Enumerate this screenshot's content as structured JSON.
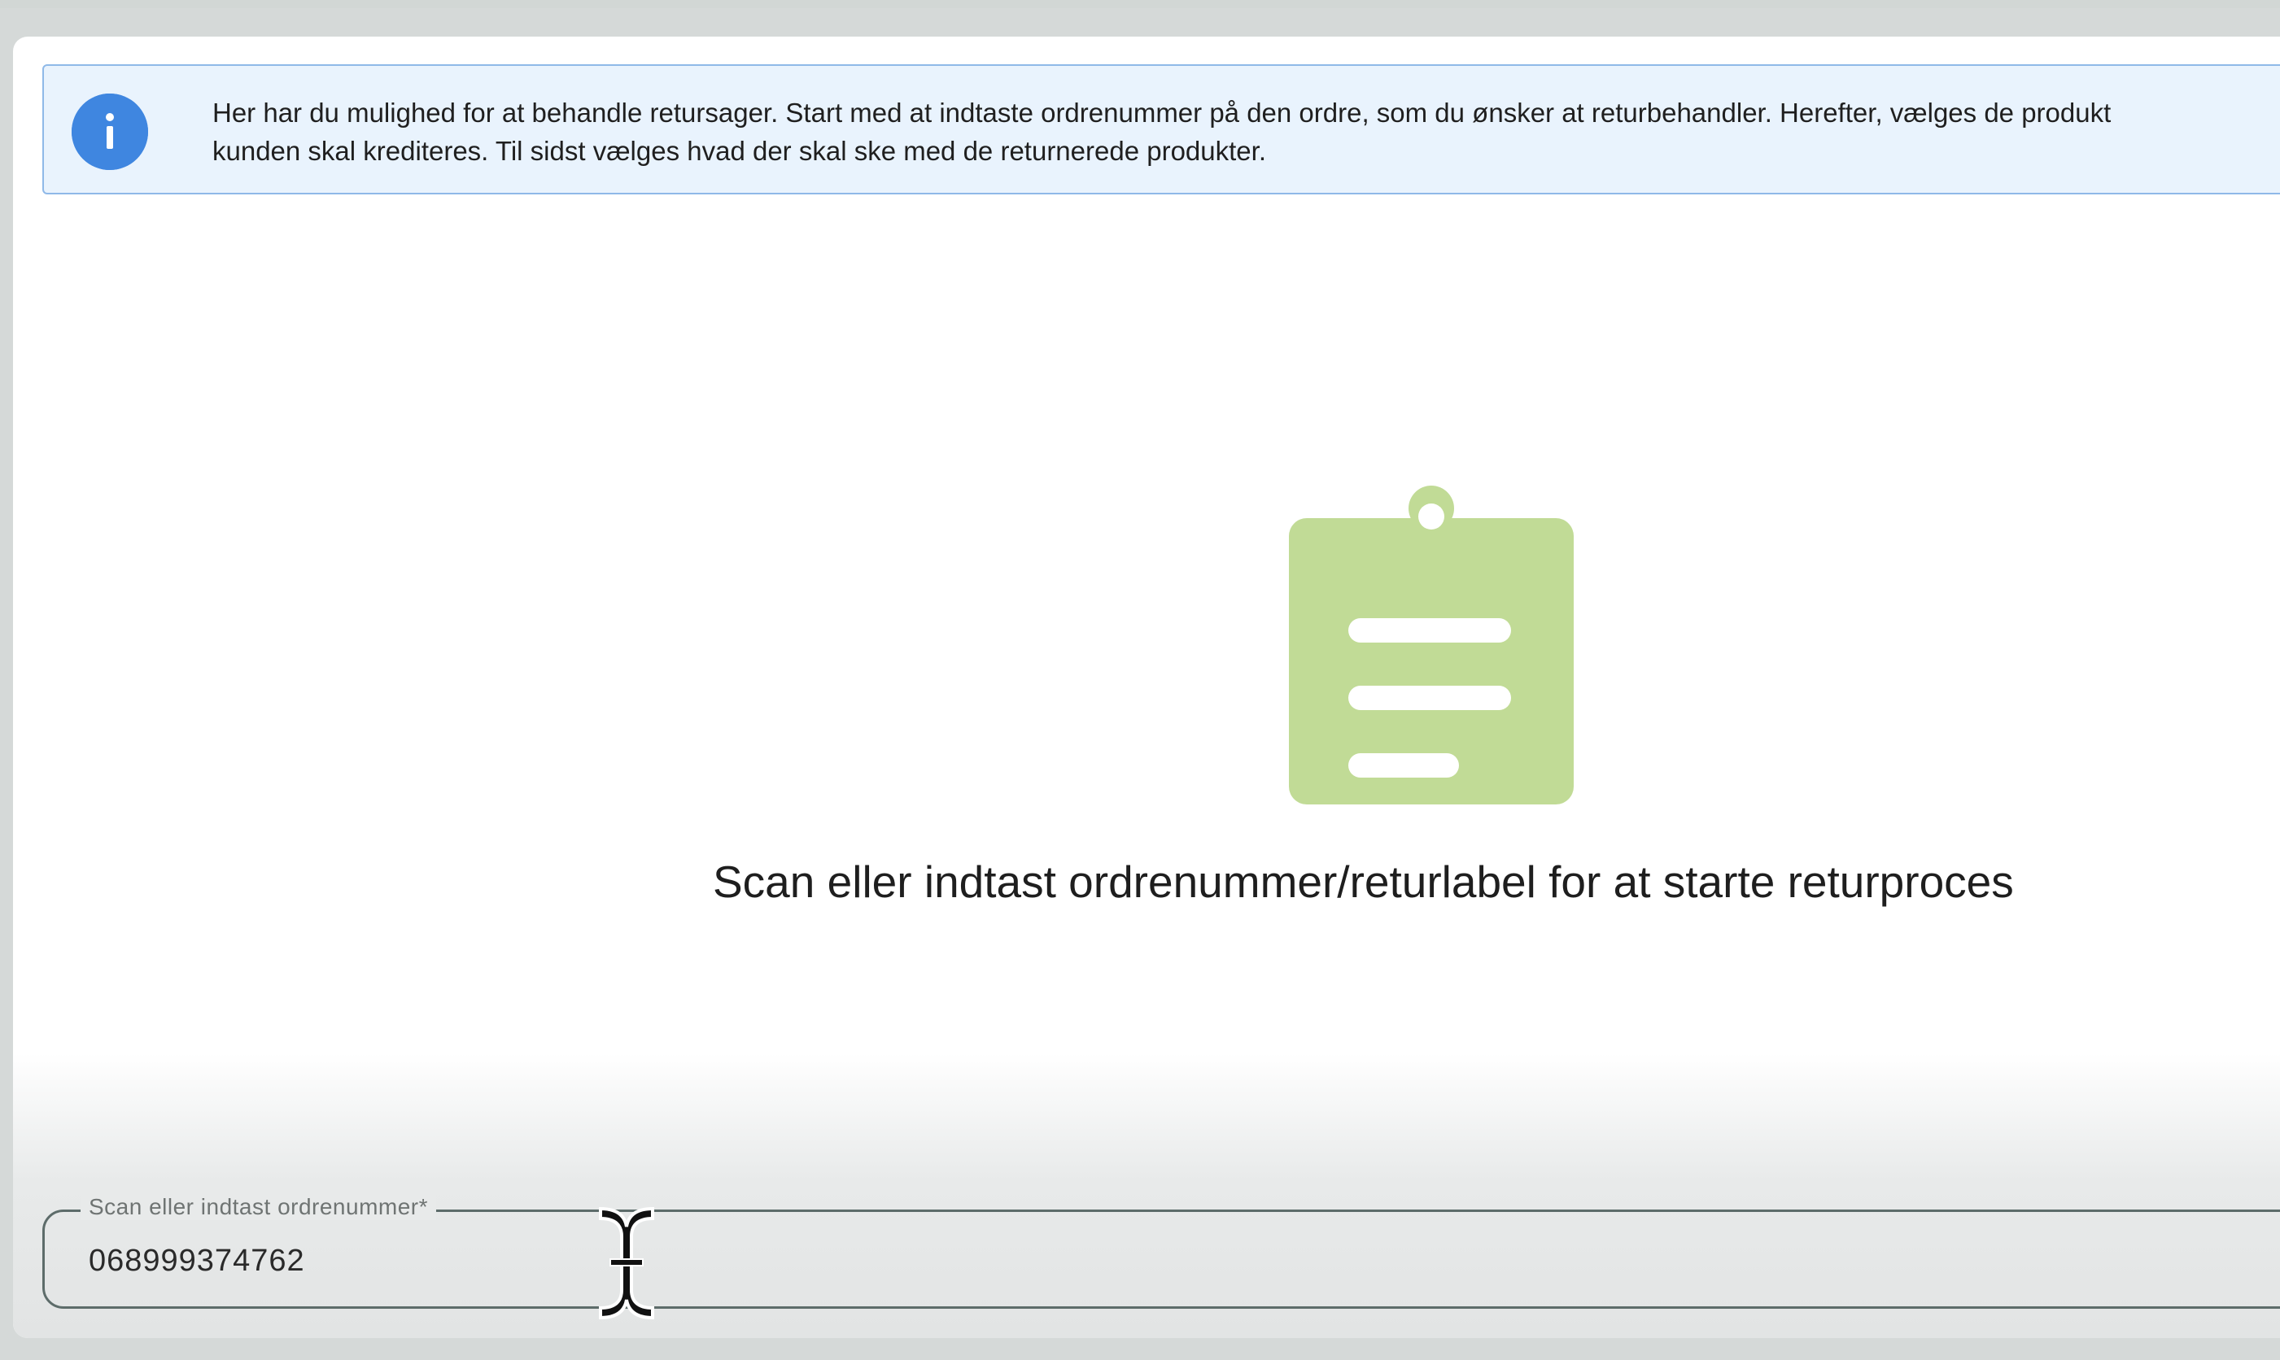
{
  "banner": {
    "icon": "info-icon",
    "line1": "Her har du mulighed for at behandle retursager. Start med at indtaste ordrenummer på den ordre, som du ønsker at returbehandler. Herefter, vælges de produkt",
    "line2": "kunden skal krediteres. Til sidst vælges hvad der skal ske med de returnerede produkter."
  },
  "empty_state": {
    "icon": "clipboard-icon",
    "message": "Scan eller indtast ordrenummer/returlabel for at starte returproces"
  },
  "order_field": {
    "label": "Scan eller indtast ordrenummer*",
    "value": "068999374762"
  },
  "colors": {
    "info_blue": "#3f86e0",
    "banner_bg": "#e9f3fd",
    "clipboard_green": "#c1db96"
  }
}
